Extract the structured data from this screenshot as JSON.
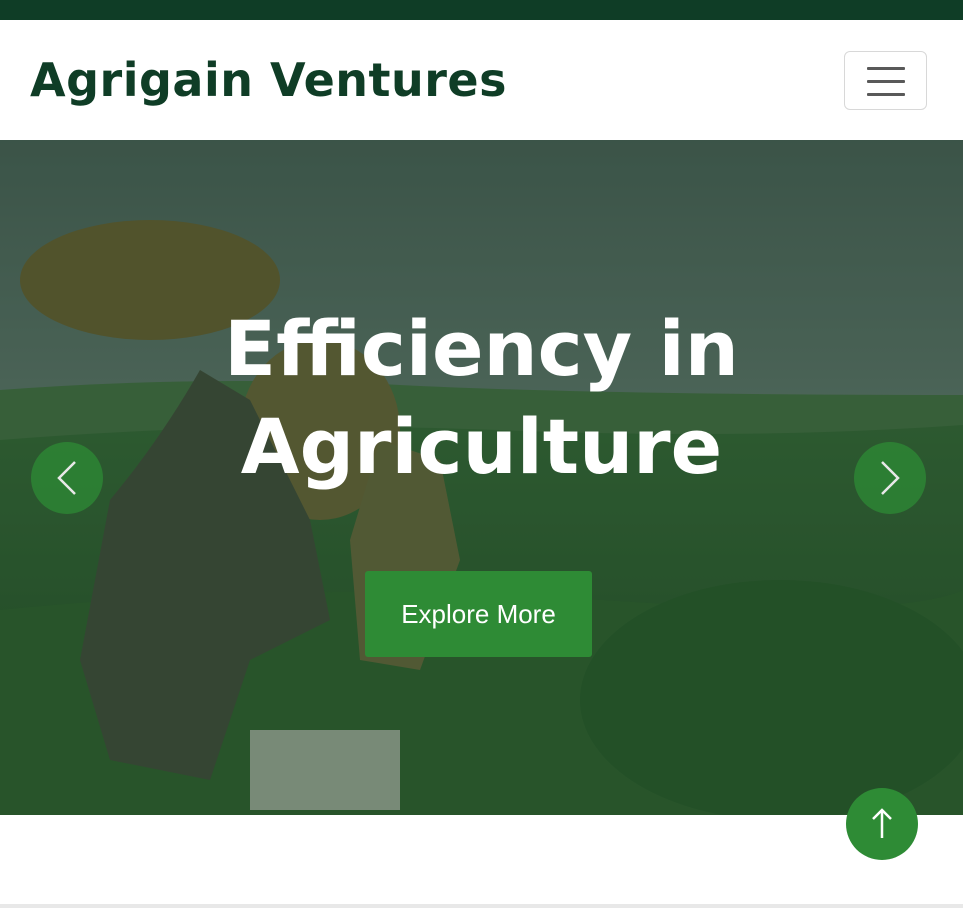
{
  "brand": {
    "name": "Agrigain Ventures",
    "color": "#0f3d26"
  },
  "nav": {
    "toggler_icon": "hamburger-menu-icon"
  },
  "hero": {
    "headline_line1": "Efficiency in",
    "headline_line2": "Agriculture",
    "cta_label": "Explore More",
    "prev_icon": "chevron-left-icon",
    "next_icon": "chevron-right-icon",
    "accent": "#2e8b35"
  },
  "back_to_top": {
    "icon": "arrow-up-icon"
  }
}
